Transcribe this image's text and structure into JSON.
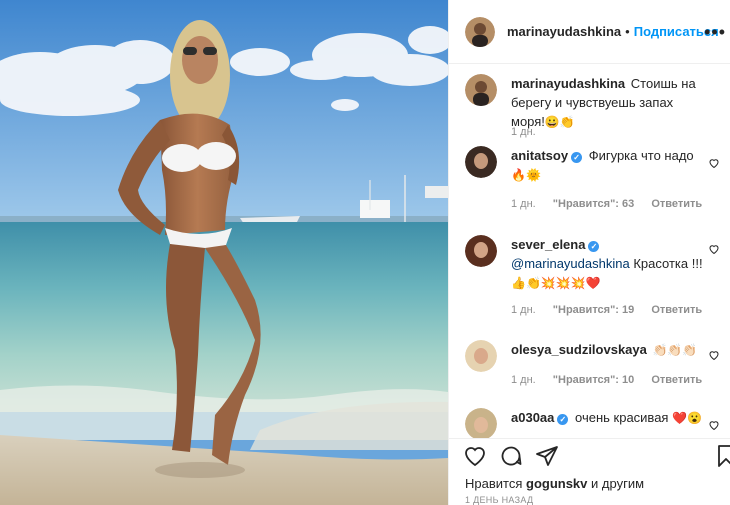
{
  "header": {
    "username": "marinayudashkina",
    "separator": "•",
    "follow_label": "Подписаться",
    "more_glyph": "•••"
  },
  "caption": {
    "username": "marinayudashkina",
    "text": "Стоишь на берегу и чувствуешь запах моря!",
    "emoji": "😀👏",
    "time": "1 дн."
  },
  "comments": [
    {
      "username": "anitatsoy",
      "verified": true,
      "text": "Фигурка что надо",
      "emoji": "🔥🌞",
      "time": "1 дн.",
      "likes": "\"Нравится\": 63",
      "reply": "Ответить"
    },
    {
      "username": "sever_elena",
      "verified": true,
      "mention": "@marinayudashkina",
      "text": "Красотка !!!",
      "emoji": "👍👏💥💥💥❤️",
      "time": "1 дн.",
      "likes": "\"Нравится\": 19",
      "reply": "Ответить"
    },
    {
      "username": "olesya_sudzilovskaya",
      "verified": false,
      "text": "",
      "emoji": "👏🏻👏🏻👏🏻",
      "time": "1 дн.",
      "likes": "\"Нравится\": 10",
      "reply": "Ответить"
    },
    {
      "username": "a030aa",
      "verified": true,
      "text": "очень красивая",
      "emoji": "❤️😮",
      "time": "",
      "likes": "",
      "reply": ""
    }
  ],
  "actions": {
    "icons": [
      "heart-icon",
      "comment-icon",
      "share-icon",
      "bookmark-icon"
    ],
    "liked_by_prefix": "Нравится",
    "liked_by_user": "gogunskv",
    "liked_by_suffix": "и другим",
    "timestamp": "1 ДЕНЬ НАЗАД"
  },
  "colors": {
    "link_blue": "#0095f6",
    "verified_blue": "#3897f0",
    "secondary_text": "#8e8e8e",
    "border": "#efefef"
  }
}
